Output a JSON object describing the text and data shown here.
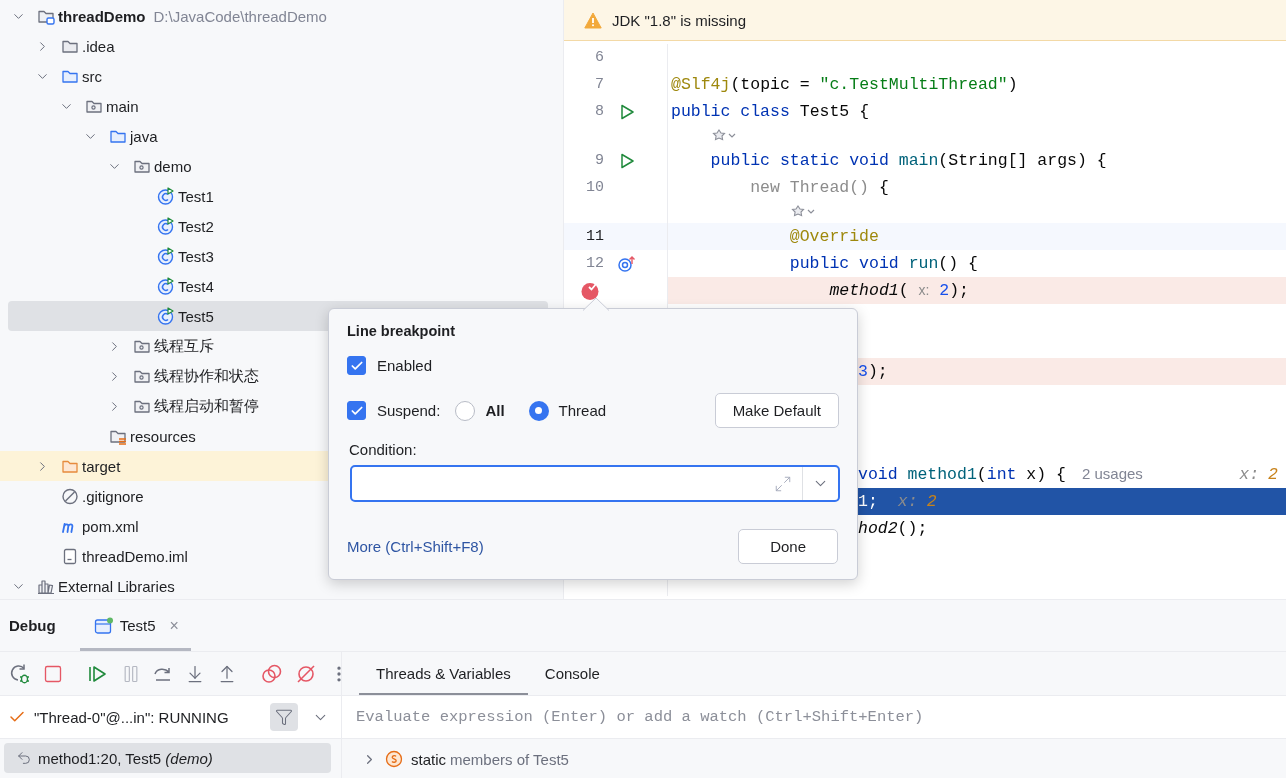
{
  "project": {
    "items": [
      {
        "label": "threadDemo",
        "path": "D:\\JavaCode\\threadDemo",
        "kind": "module",
        "expanded": true,
        "selected": false,
        "children": [
          {
            "label": ".idea",
            "kind": "folder",
            "expanded": false,
            "selected": false
          },
          {
            "label": "src",
            "kind": "source_folder",
            "expanded": true,
            "selected": false,
            "children": [
              {
                "label": "main",
                "kind": "package",
                "expanded": true,
                "selected": false,
                "children": [
                  {
                    "label": "java",
                    "kind": "source_folder",
                    "expanded": true,
                    "selected": false,
                    "children": [
                      {
                        "label": "demo",
                        "kind": "package",
                        "expanded": true,
                        "selected": false,
                        "children": [
                          {
                            "label": "Test1",
                            "kind": "class",
                            "selected": false
                          },
                          {
                            "label": "Test2",
                            "kind": "class",
                            "selected": false
                          },
                          {
                            "label": "Test3",
                            "kind": "class",
                            "selected": false
                          },
                          {
                            "label": "Test4",
                            "kind": "class",
                            "selected": false
                          },
                          {
                            "label": "Test5",
                            "kind": "class",
                            "selected": true
                          }
                        ]
                      },
                      {
                        "label": "线程互斥",
                        "kind": "package",
                        "expanded": false,
                        "selected": false
                      },
                      {
                        "label": "线程协作和状态",
                        "kind": "package",
                        "expanded": false,
                        "selected": false
                      },
                      {
                        "label": "线程启动和暂停",
                        "kind": "package",
                        "expanded": false,
                        "selected": false
                      }
                    ]
                  },
                  {
                    "label": "resources",
                    "kind": "resources",
                    "selected": false
                  }
                ]
              }
            ]
          },
          {
            "label": "target",
            "kind": "excluded",
            "expanded": false,
            "selected": false
          },
          {
            "label": ".gitignore",
            "kind": "ignore_file",
            "selected": false
          },
          {
            "label": "pom.xml",
            "kind": "maven",
            "selected": false
          },
          {
            "label": "threadDemo.iml",
            "kind": "module_file",
            "selected": false
          }
        ]
      },
      {
        "label": "External Libraries",
        "kind": "libraries",
        "expanded": true,
        "selected": false
      }
    ]
  },
  "editor": {
    "notification": {
      "kind": "warning",
      "text": "JDK \"1.8\" is missing"
    },
    "lines": [
      {
        "kind": "line",
        "number": "6",
        "breakpoint": false,
        "execution_point": false
      },
      {
        "kind": "line",
        "number": "7",
        "breakpoint": false,
        "execution_point": false,
        "tokens": [
          {
            "text": "@Slf4j",
            "kind": "annotation"
          },
          {
            "text": "(topic = ",
            "kind": "plain"
          },
          {
            "text": "\"c.TestMultiThread\"",
            "kind": "string"
          },
          {
            "text": ")",
            "kind": "plain"
          }
        ]
      },
      {
        "kind": "line",
        "number": "8",
        "gutter_icon": {
          "kind": "run"
        },
        "breakpoint": false,
        "execution_point": false,
        "tokens": [
          {
            "text": "public class ",
            "kind": "keyword"
          },
          {
            "text": "Test5 {",
            "kind": "plain"
          }
        ],
        "children": [
          {
            "kind": "inlay"
          },
          {
            "kind": "line",
            "number": "9",
            "gutter_icon": {
              "kind": "run"
            },
            "breakpoint": false,
            "execution_point": false,
            "tokens": [
              {
                "text": "public static void ",
                "kind": "keyword"
              },
              {
                "text": "main",
                "kind": "method"
              },
              {
                "text": "(String[] args) {",
                "kind": "plain"
              }
            ],
            "children": [
              {
                "kind": "line",
                "number": "10",
                "breakpoint": false,
                "execution_point": false,
                "tokens": [
                  {
                    "text": "new Thread() ",
                    "kind": "dim"
                  },
                  {
                    "text": "{",
                    "kind": "plain"
                  }
                ],
                "children": [
                  {
                    "kind": "inlay"
                  },
                  {
                    "kind": "line",
                    "number": "11",
                    "caret_line": true,
                    "breakpoint": false,
                    "execution_point": false,
                    "tokens": [
                      {
                        "text": "@Override",
                        "kind": "annotation"
                      }
                    ]
                  },
                  {
                    "kind": "line",
                    "number": "12",
                    "gutter_icon": {
                      "kind": "override"
                    },
                    "breakpoint": false,
                    "execution_point": false,
                    "tokens": [
                      {
                        "text": "public void ",
                        "kind": "keyword"
                      },
                      {
                        "text": "run",
                        "kind": "method"
                      },
                      {
                        "text": "() {",
                        "kind": "plain"
                      }
                    ],
                    "children": [
                      {
                        "kind": "line",
                        "gutter_icon": {
                          "kind": "breakpoint"
                        },
                        "breakpoint": true,
                        "execution_point": false,
                        "tokens": [
                          {
                            "text": "method1",
                            "kind": "italic"
                          },
                          {
                            "text": "( ",
                            "kind": "plain"
                          },
                          {
                            "text": "x:",
                            "kind": "hint"
                          },
                          {
                            "text": " 2",
                            "kind": "number"
                          },
                          {
                            "text": ");",
                            "kind": "plain"
                          }
                        ]
                      }
                    ]
                  }
                ]
              }
            ]
          }
        ]
      },
      {
        "kind": "line",
        "breakpoint": false,
        "execution_point": false
      },
      {
        "kind": "line",
        "breakpoint": false,
        "execution_point": false
      },
      {
        "kind": "tail",
        "breakpoint": true,
        "execution_point": false,
        "tokens": [
          {
            "text": "3",
            "kind": "number"
          },
          {
            "text": ");",
            "kind": "plain"
          }
        ]
      },
      {
        "kind": "line",
        "breakpoint": false,
        "execution_point": false
      },
      {
        "kind": "line",
        "breakpoint": false,
        "execution_point": false
      },
      {
        "kind": "gap"
      },
      {
        "kind": "tail",
        "breakpoint": false,
        "execution_point": false,
        "tokens": [
          {
            "text": "void ",
            "kind": "keyword"
          },
          {
            "text": "method1",
            "kind": "method"
          },
          {
            "text": "(",
            "kind": "plain"
          },
          {
            "text": "int",
            "kind": "keyword"
          },
          {
            "text": " x) {",
            "kind": "plain"
          },
          {
            "text": "2 usages",
            "kind": "usages"
          }
        ],
        "values": [
          {
            "text": "x:",
            "kind": "value_name"
          },
          {
            "text": "2",
            "kind": "value_num"
          }
        ]
      },
      {
        "kind": "tail",
        "execution_point": true,
        "tokens": [
          {
            "text": "1;",
            "kind": "plain"
          },
          {
            "text": "x:",
            "kind": "value_name"
          },
          {
            "text": "2",
            "kind": "value_num"
          }
        ]
      },
      {
        "kind": "tail",
        "breakpoint": false,
        "execution_point": false,
        "tokens": [
          {
            "text": "hod2",
            "kind": "italic"
          },
          {
            "text": "();",
            "kind": "plain"
          }
        ]
      },
      {
        "kind": "line",
        "breakpoint": false,
        "execution_point": false
      },
      {
        "kind": "line",
        "breakpoint": false,
        "execution_point": false
      }
    ]
  },
  "breakpoint_popup": {
    "title": "Line breakpoint",
    "enabled": {
      "label": "Enabled",
      "checked": true
    },
    "suspend": {
      "label": "Suspend:",
      "checked": true
    },
    "suspend_scope": [
      {
        "label": "All",
        "selected": false,
        "bold": true
      },
      {
        "label": "Thread",
        "selected": true,
        "bold": false
      }
    ],
    "make_default": "Make Default",
    "condition": {
      "label": "Condition:"
    },
    "more_link": "More (Ctrl+Shift+F8)",
    "done": "Done"
  },
  "debug": {
    "title": "Debug",
    "session_tabs": [
      {
        "label": "Test5",
        "close": "×",
        "selected": true
      }
    ],
    "toolbar": [
      {
        "kind": "rerun",
        "disabled": false
      },
      {
        "kind": "stop",
        "disabled": false
      },
      {
        "kind": "separator"
      },
      {
        "kind": "resume",
        "disabled": false
      },
      {
        "kind": "pause",
        "disabled": true
      },
      {
        "kind": "step_over",
        "disabled": false
      },
      {
        "kind": "step_into",
        "disabled": false
      },
      {
        "kind": "step_out",
        "disabled": false
      },
      {
        "kind": "separator"
      },
      {
        "kind": "breakpoints",
        "disabled": false
      },
      {
        "kind": "mute",
        "disabled": false
      },
      {
        "kind": "more",
        "disabled": false
      }
    ],
    "view_tabs": [
      {
        "label": "Threads & Variables",
        "selected": true
      },
      {
        "label": "Console",
        "selected": false
      }
    ],
    "thread": {
      "label": "\"Thread-0\"@...in\": RUNNING",
      "filter_on": true
    },
    "frames": [
      {
        "text": "method1:20, Test5 *(demo)*",
        "selected": true
      }
    ],
    "evaluate": {
      "placeholder": "Evaluate expression (Enter) or add a watch (Ctrl+Shift+Enter)"
    },
    "variables": [
      {
        "keyword": "static",
        "label": "members of Test5",
        "expanded": false
      }
    ]
  }
}
